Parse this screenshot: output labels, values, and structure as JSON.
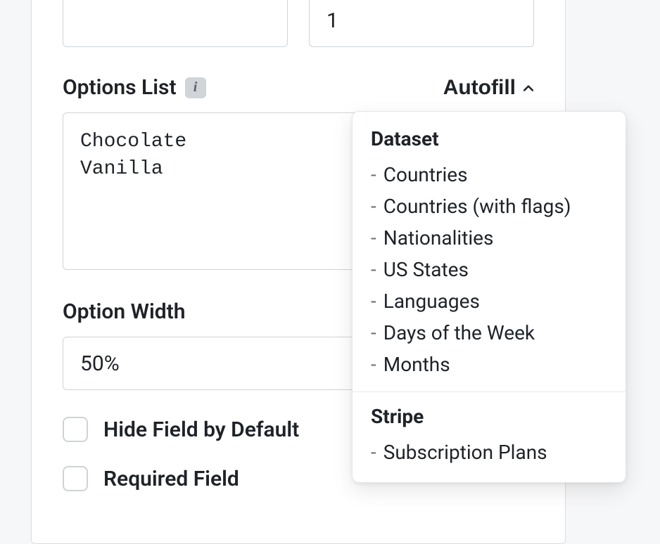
{
  "topRow": {
    "leftValue": "",
    "rightValue": "1"
  },
  "optionsList": {
    "label": "Options List",
    "value": "Chocolate\nVanilla",
    "autofillLabel": "Autofill"
  },
  "optionWidth": {
    "label": "Option Width",
    "value": "50%"
  },
  "checkboxes": {
    "hideField": {
      "label": "Hide Field by Default",
      "checked": false
    },
    "requiredField": {
      "label": "Required Field",
      "checked": false
    }
  },
  "dropdown": {
    "sections": [
      {
        "heading": "Dataset",
        "items": [
          "Countries",
          "Countries (with flags)",
          "Nationalities",
          "US States",
          "Languages",
          "Days of the Week",
          "Months"
        ]
      },
      {
        "heading": "Stripe",
        "items": [
          "Subscription Plans"
        ]
      }
    ]
  }
}
